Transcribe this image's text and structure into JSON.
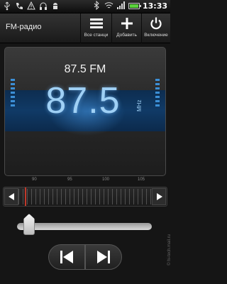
{
  "status_bar": {
    "time": "13:33",
    "icons": [
      "usb-icon",
      "phone-icon",
      "warning-icon",
      "headphones-icon",
      "android-icon",
      "bluetooth-icon",
      "wifi-icon",
      "signal-icon",
      "battery-icon"
    ],
    "battery_level": 0.9,
    "battery_color": "#5ad13c"
  },
  "title_bar": {
    "title": "FM-радио",
    "buttons": [
      {
        "label": "Все станци",
        "icon": "list-icon"
      },
      {
        "label": "Добавить",
        "icon": "plus-icon"
      },
      {
        "label": "Включение",
        "icon": "power-icon"
      }
    ]
  },
  "display": {
    "station": "87.5 FM",
    "frequency": "87.5",
    "unit": "MHz",
    "accent": "#9fd0f5"
  },
  "tuner": {
    "tick_labels": [
      "90",
      "95",
      "100",
      "105"
    ],
    "needle_value": 87.5,
    "range": [
      87.5,
      108
    ]
  },
  "volume": {
    "level": 0.04
  },
  "watermark": "© hi-tech.mail.ru"
}
